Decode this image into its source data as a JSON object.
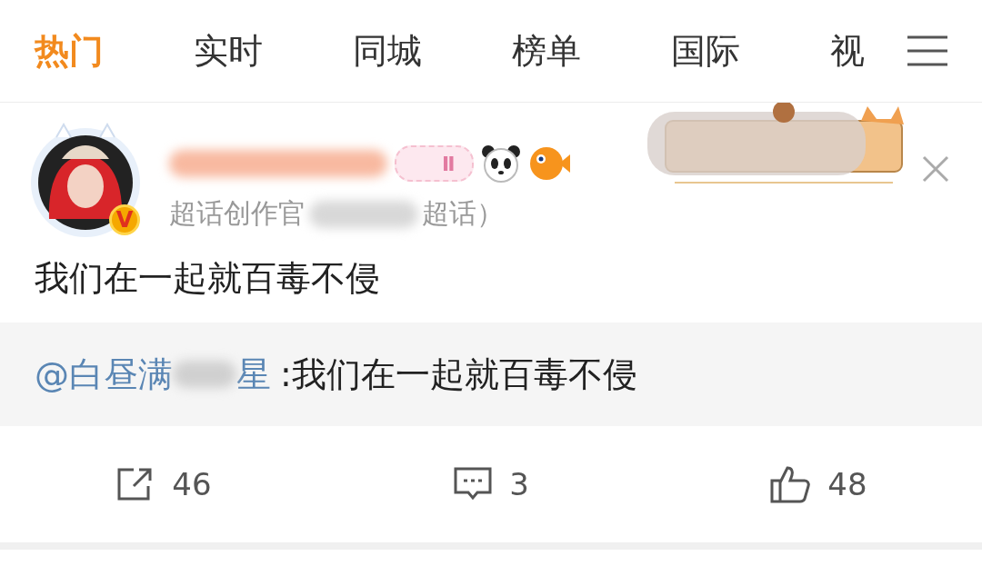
{
  "tabs": [
    {
      "label": "热门",
      "selected": true
    },
    {
      "label": "实时",
      "selected": false
    },
    {
      "label": "同城",
      "selected": false
    },
    {
      "label": "榜单",
      "selected": false
    },
    {
      "label": "国际",
      "selected": false
    },
    {
      "label": "视",
      "selected": false
    }
  ],
  "post": {
    "avatar": {
      "verified_mark": "V"
    },
    "level_badge": "Ⅱ",
    "subtitle_start": "超话创作官",
    "subtitle_end": "超话）",
    "text": "我们在一起就百毒不侵",
    "repost": {
      "mention_start": "@白昼满",
      "mention_end": "星",
      "text": ":我们在一起就百毒不侵"
    },
    "actions": [
      {
        "kind": "share",
        "count": "46"
      },
      {
        "kind": "comment",
        "count": "3"
      },
      {
        "kind": "like",
        "count": "48"
      }
    ]
  }
}
